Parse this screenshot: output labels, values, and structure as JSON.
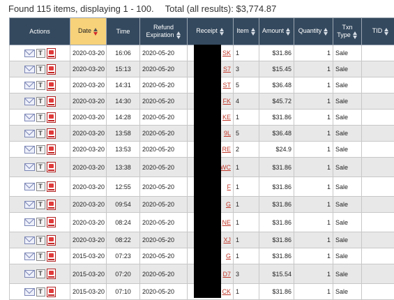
{
  "summary": {
    "found_text": "Found 115 items, displaying 1 - 100.",
    "total_text": "Total (all results): $3,774.87"
  },
  "table": {
    "headers": {
      "actions": "Actions",
      "date": "Date",
      "time": "Time",
      "refund_expiration": "Refund Expiration",
      "receipt": "Receipt",
      "item": "Item",
      "amount": "Amount",
      "quantity": "Quantity",
      "txn_type": "Txn Type",
      "tid": "TID"
    },
    "sorted_column": "Date",
    "rows": [
      {
        "date": "2020-03-20",
        "time": "16:06",
        "refund_exp": "2020-05-20",
        "receipt_suffix": "SK",
        "item": "1",
        "amount": "$31.86",
        "quantity": "1",
        "txn_type": "Sale",
        "tid": ""
      },
      {
        "date": "2020-03-20",
        "time": "15:13",
        "refund_exp": "2020-05-20",
        "receipt_suffix": "S7",
        "item": "3",
        "amount": "$15.45",
        "quantity": "1",
        "txn_type": "Sale",
        "tid": ""
      },
      {
        "date": "2020-03-20",
        "time": "14:31",
        "refund_exp": "2020-05-20",
        "receipt_suffix": "ST",
        "item": "5",
        "amount": "$36.48",
        "quantity": "1",
        "txn_type": "Sale",
        "tid": ""
      },
      {
        "date": "2020-03-20",
        "time": "14:30",
        "refund_exp": "2020-05-20",
        "receipt_suffix": "FK",
        "item": "4",
        "amount": "$45.72",
        "quantity": "1",
        "txn_type": "Sale",
        "tid": ""
      },
      {
        "date": "2020-03-20",
        "time": "14:28",
        "refund_exp": "2020-05-20",
        "receipt_suffix": "KE",
        "item": "1",
        "amount": "$31.86",
        "quantity": "1",
        "txn_type": "Sale",
        "tid": ""
      },
      {
        "date": "2020-03-20",
        "time": "13:58",
        "refund_exp": "2020-05-20",
        "receipt_suffix": "9L",
        "item": "5",
        "amount": "$36.48",
        "quantity": "1",
        "txn_type": "Sale",
        "tid": ""
      },
      {
        "date": "2020-03-20",
        "time": "13:53",
        "refund_exp": "2020-05-20",
        "receipt_suffix": "RE",
        "item": "2",
        "amount": "$24.9",
        "quantity": "1",
        "txn_type": "Sale",
        "tid": ""
      },
      {
        "date": "2020-03-20",
        "time": "13:38",
        "refund_exp": "2020-05-20",
        "receipt_suffix": "WC",
        "item": "1",
        "amount": "$31.86",
        "quantity": "1",
        "txn_type": "Sale",
        "tid": ""
      },
      {
        "date": "2020-03-20",
        "time": "12:55",
        "refund_exp": "2020-05-20",
        "receipt_suffix": "F",
        "item": "1",
        "amount": "$31.86",
        "quantity": "1",
        "txn_type": "Sale",
        "tid": ""
      },
      {
        "date": "2020-03-20",
        "time": "09:54",
        "refund_exp": "2020-05-20",
        "receipt_suffix": "G",
        "item": "1",
        "amount": "$31.86",
        "quantity": "1",
        "txn_type": "Sale",
        "tid": ""
      },
      {
        "date": "2020-03-20",
        "time": "08:24",
        "refund_exp": "2020-05-20",
        "receipt_suffix": "NE",
        "item": "1",
        "amount": "$31.86",
        "quantity": "1",
        "txn_type": "Sale",
        "tid": ""
      },
      {
        "date": "2020-03-20",
        "time": "08:22",
        "refund_exp": "2020-05-20",
        "receipt_suffix": "XJ",
        "item": "1",
        "amount": "$31.86",
        "quantity": "1",
        "txn_type": "Sale",
        "tid": ""
      },
      {
        "date": "2015-03-20",
        "time": "07:23",
        "refund_exp": "2020-05-20",
        "receipt_suffix": "G",
        "item": "1",
        "amount": "$31.86",
        "quantity": "1",
        "txn_type": "Sale",
        "tid": ""
      },
      {
        "date": "2015-03-20",
        "time": "07:20",
        "refund_exp": "2020-05-20",
        "receipt_suffix": "D7",
        "item": "3",
        "amount": "$15.54",
        "quantity": "1",
        "txn_type": "Sale",
        "tid": ""
      },
      {
        "date": "2015-03-20",
        "time": "07:10",
        "refund_exp": "2020-05-20",
        "receipt_suffix": "CK",
        "item": "1",
        "amount": "$31.86",
        "quantity": "1",
        "txn_type": "Sale",
        "tid": ""
      }
    ],
    "action_icons": [
      "envelope-icon",
      "text-document-icon",
      "pdf-icon"
    ]
  }
}
